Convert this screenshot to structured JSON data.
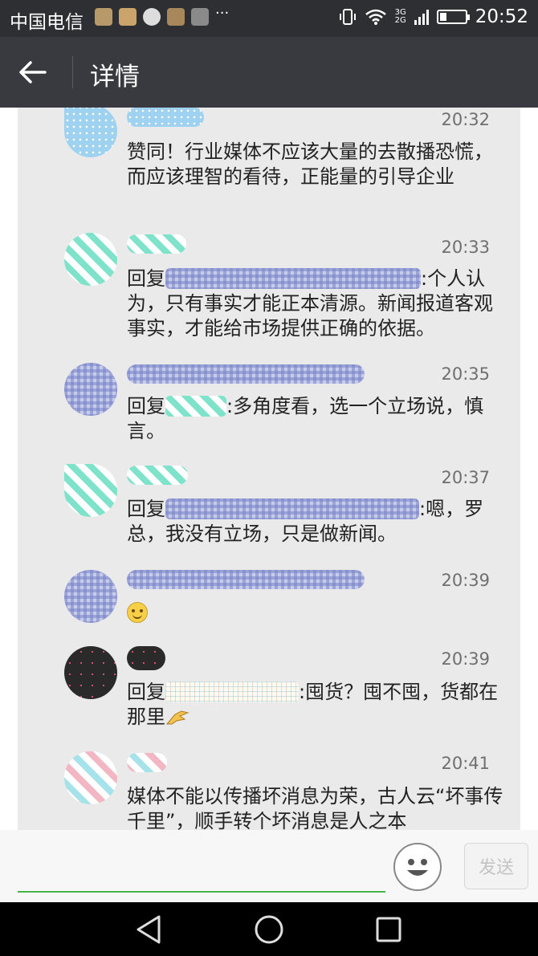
{
  "status_bar": {
    "carrier": "中国电信",
    "more_indicator": "···",
    "network_top": "3G",
    "network_bottom": "2G",
    "battery_level": 0.25,
    "time": "20:52"
  },
  "title_bar": {
    "title": "详情",
    "back_icon": "arrow-left-icon"
  },
  "comments": [
    {
      "time": "20:32",
      "avatar_style": "dots",
      "text": "赞同！行业媒体不应该大量的去散播恐慌，而应该理智的看待，正能量的引导企业"
    },
    {
      "time": "20:33",
      "avatar_style": "stripe",
      "reply_prefix": "回复",
      "reply_suffix": ":个人认为，只有事实才能正本清源。新闻报道客观事实，才能给市场提供正确的依据。"
    },
    {
      "time": "20:35",
      "avatar_style": "check",
      "reply_prefix": "回复",
      "reply_suffix": ":多角度看，选一个立场说，慎言。"
    },
    {
      "time": "20:37",
      "avatar_style": "stripe",
      "reply_prefix": "回复",
      "reply_suffix": ":嗯，罗总，我没有立场，只是做新闻。"
    },
    {
      "time": "20:39",
      "avatar_style": "check",
      "emoji": "smile-emoji"
    },
    {
      "time": "20:39",
      "avatar_style": "dark",
      "reply_prefix": "回复",
      "reply_suffix": ":囤货？囤不囤，货都在那里",
      "trailing_emoji": "ok-hand-emoji"
    },
    {
      "time": "20:41",
      "avatar_style": "pink",
      "text": "媒体不能以传播坏消息为荣，古人云“坏事传千里”，顺手转个坏消息是人之本"
    }
  ],
  "input_bar": {
    "placeholder": "",
    "emoji_icon": "smiley-icon",
    "send_label": "发送"
  },
  "nav_bar": {
    "back_icon": "triangle-back-icon",
    "home_icon": "circle-home-icon",
    "recents_icon": "square-recents-icon"
  }
}
